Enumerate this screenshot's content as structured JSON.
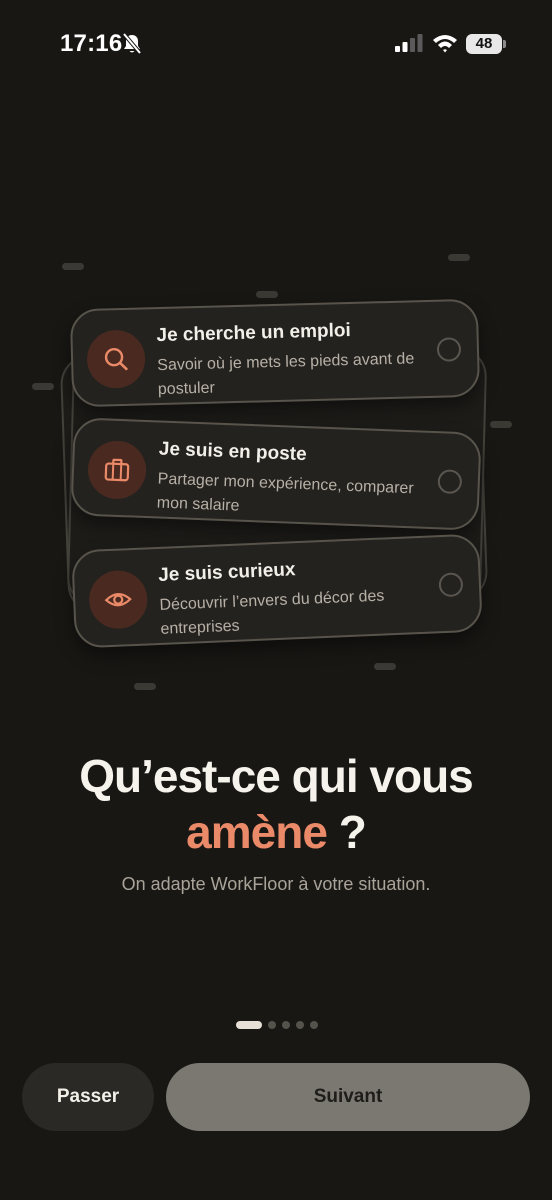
{
  "status_bar": {
    "time": "17:16",
    "battery_level": "48",
    "icons": [
      "bell-slash-icon",
      "cellular-signal-icon",
      "wifi-icon",
      "battery-icon"
    ]
  },
  "options": [
    {
      "title": "Je cherche un emploi",
      "description": "Savoir où je mets les pieds avant de postuler",
      "icon": "search-icon",
      "selected": false
    },
    {
      "title": "Je suis en poste",
      "description": "Partager mon expérience, comparer mon salaire",
      "icon": "briefcase-icon",
      "selected": false
    },
    {
      "title": "Je suis curieux",
      "description": "Découvrir l’envers du décor des entreprises",
      "icon": "eye-icon",
      "selected": false
    }
  ],
  "heading": {
    "line1": "Qu’est-ce qui vous",
    "accent": "amène",
    "suffix": " ?"
  },
  "subtitle": "On adapte WorkFloor à votre situation.",
  "pager": {
    "total": 5,
    "current": 1
  },
  "buttons": {
    "skip": "Passer",
    "next": "Suivant"
  },
  "colors": {
    "background": "#181714",
    "accent": "#ea8a68",
    "card": "#24221f",
    "next_button": "#7b7872",
    "skip_button": "#2b2925"
  }
}
